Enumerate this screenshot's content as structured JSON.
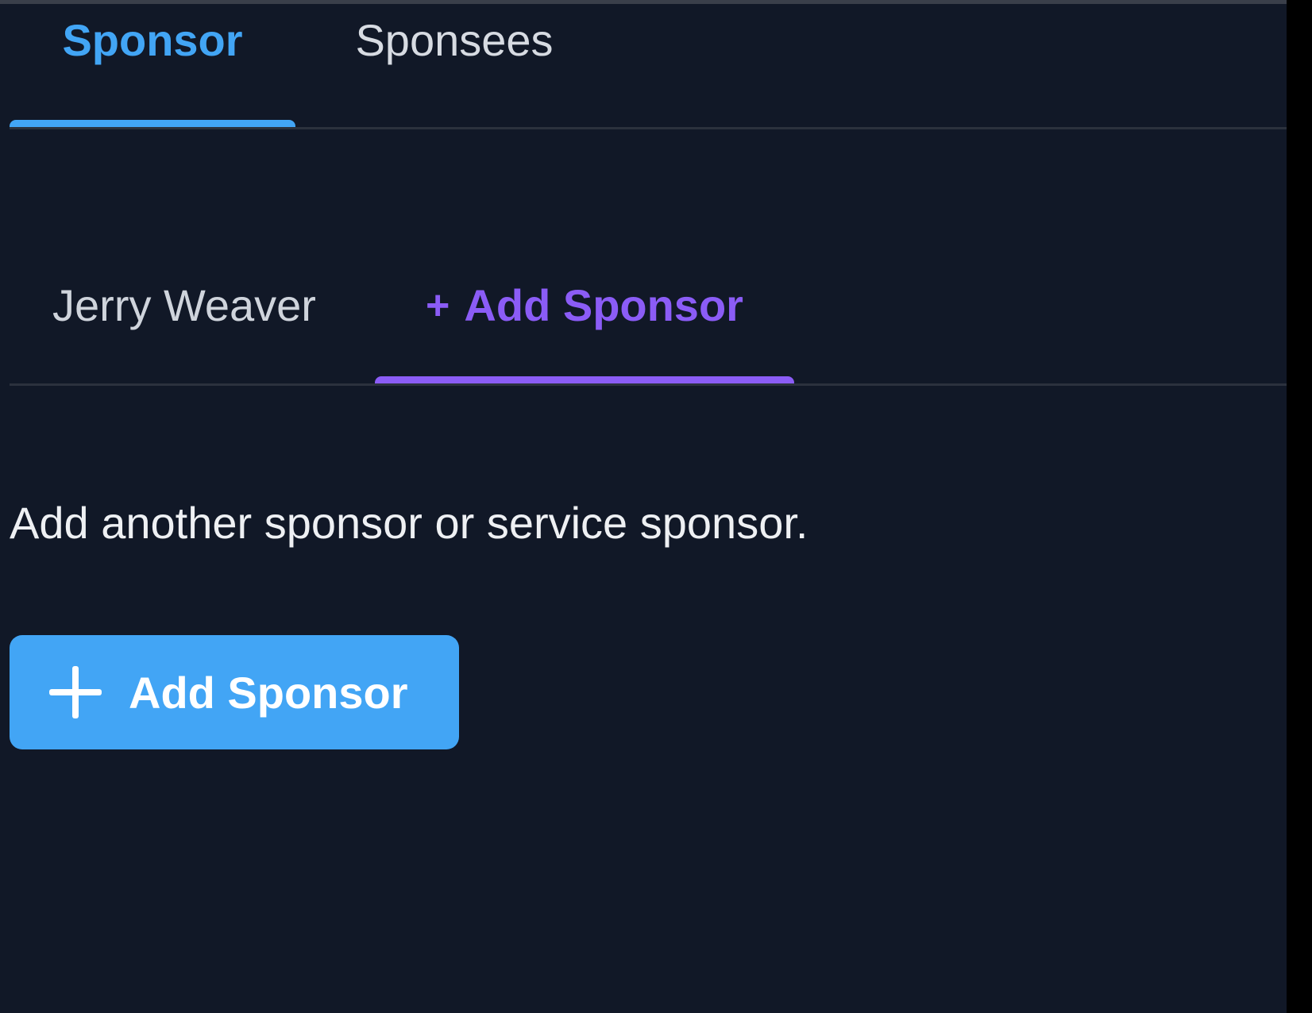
{
  "primary_tabs": {
    "items": [
      {
        "label": "Sponsor",
        "active": true
      },
      {
        "label": "Sponsees",
        "active": false
      }
    ]
  },
  "sponsor_tabs": {
    "items": [
      {
        "label": "Jerry Weaver",
        "active": false
      },
      {
        "label": "Add Sponsor",
        "prefix": "+",
        "active": true
      }
    ]
  },
  "content": {
    "description": "Add another sponsor or service sponsor.",
    "add_button_label": "Add Sponsor",
    "add_button_icon": "plus-icon"
  },
  "colors": {
    "background": "#111827",
    "primary_accent": "#42a5f5",
    "secondary_accent": "#8b5cf6",
    "text": "#eef0f3"
  }
}
